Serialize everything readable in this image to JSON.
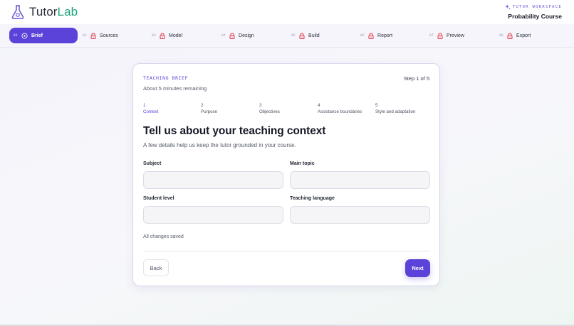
{
  "header": {
    "logo": {
      "part1": "Tutor",
      "part2": "Lab",
      "icon": "flask-icon"
    },
    "workspace_label": "TUTOR WORKSPACE",
    "workspace_name": "Probability Course"
  },
  "nav": {
    "steps": [
      {
        "num": "01",
        "label": "Brief",
        "state": "active"
      },
      {
        "num": "02",
        "label": "Sources",
        "state": "locked"
      },
      {
        "num": "03",
        "label": "Model",
        "state": "locked"
      },
      {
        "num": "04",
        "label": "Design",
        "state": "locked"
      },
      {
        "num": "05",
        "label": "Build",
        "state": "locked"
      },
      {
        "num": "06",
        "label": "Report",
        "state": "locked"
      },
      {
        "num": "07",
        "label": "Preview",
        "state": "locked"
      },
      {
        "num": "08",
        "label": "Export",
        "state": "locked"
      }
    ]
  },
  "card": {
    "section_label": "TEACHING BRIEF",
    "time_remaining": "About 5 minutes remaining",
    "step_counter": "Step 1 of 5",
    "substeps": [
      {
        "num": "1",
        "label": "Context"
      },
      {
        "num": "2",
        "label": "Purpose"
      },
      {
        "num": "3",
        "label": "Objectives"
      },
      {
        "num": "4",
        "label": "Assistance boundaries"
      },
      {
        "num": "5",
        "label": "Style and adaptation"
      }
    ],
    "title": "Tell us about your teaching context",
    "subtitle": "A few details help us keep the tutor grounded in your course.",
    "fields": {
      "subject": {
        "label": "Subject",
        "value": "",
        "placeholder": ""
      },
      "main_topic": {
        "label": "Main topic",
        "value": "",
        "placeholder": ""
      },
      "student_level": {
        "label": "Student level",
        "value": "",
        "placeholder": ""
      },
      "teaching_language": {
        "label": "Teaching language",
        "value": "",
        "placeholder": ""
      }
    },
    "save_status": "All changes saved",
    "back_label": "Back",
    "next_label": "Next"
  },
  "colors": {
    "accent": "#5b43d9",
    "brand_green": "#1aa37a",
    "lock_red": "#e0434f"
  }
}
